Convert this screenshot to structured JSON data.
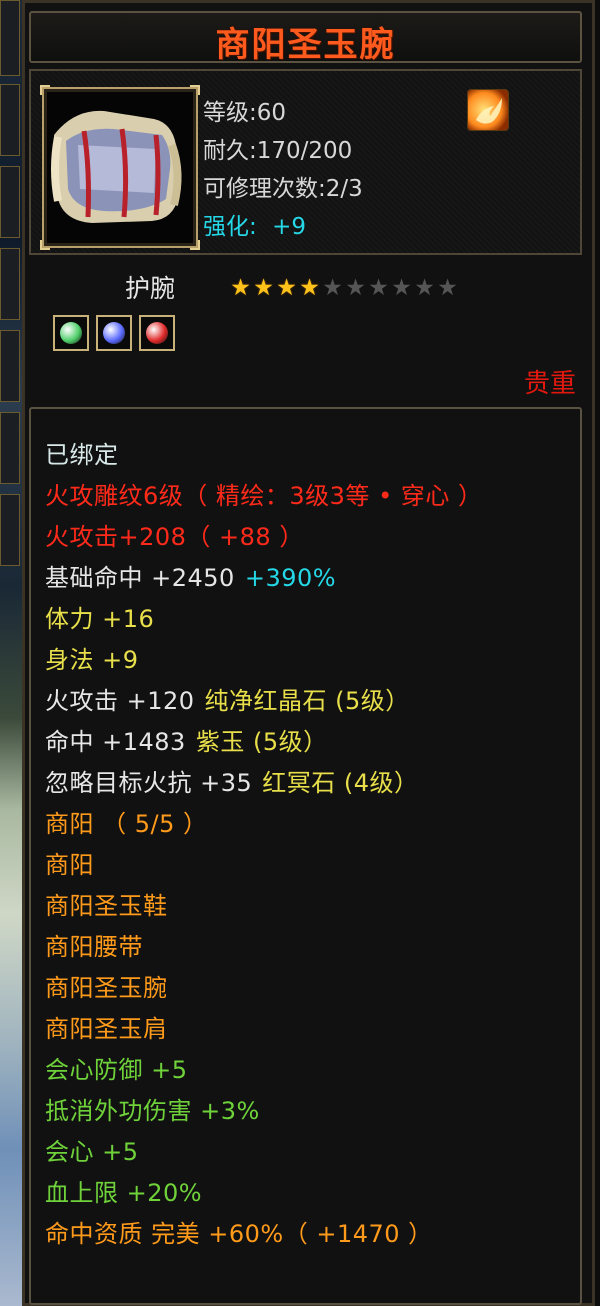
{
  "item": {
    "name": "商阳圣玉腕",
    "level": "等级:60",
    "durability": "耐久:170/200",
    "repairs": "可修理次数:2/3",
    "strength_label": "强化:",
    "strength_value": "+9",
    "slot": "护腕",
    "stars_filled": 4,
    "stars_total": 10,
    "rarity": "贵重",
    "icon": "armguard-icon",
    "element_icon": "fire-element-icon"
  },
  "gems": [
    {
      "icon": "gem-green-icon",
      "color": "#4fcf6a"
    },
    {
      "icon": "gem-blue-icon",
      "color": "#5b6bff"
    },
    {
      "icon": "gem-red-icon",
      "color": "#e02a2a"
    }
  ],
  "colors": {
    "white": "#e6e6e6",
    "red": "#ff2a1a",
    "yellow": "#e8df4a",
    "cyan": "#25d8e8",
    "orange": "#ff9a1a",
    "green": "#6fd23a",
    "title": "#ff5a1e"
  },
  "lines": [
    {
      "text": "已绑定",
      "extra": "",
      "color": "#d8e8e8",
      "extra_color": ""
    },
    {
      "text": "火攻雕纹6级（ 精绘：3级3等 • 穿心 ）",
      "extra": "",
      "color": "#ff2a1a",
      "extra_color": ""
    },
    {
      "text": "火攻击+208（ +88 ）",
      "extra": "",
      "color": "#ff2a1a",
      "extra_color": ""
    },
    {
      "text": "基础命中 +2450",
      "extra": "+390%",
      "color": "#e6e6e6",
      "extra_color": "#25d8e8"
    },
    {
      "text": "体力 +16",
      "extra": "",
      "color": "#e8df4a",
      "extra_color": ""
    },
    {
      "text": "身法 +9",
      "extra": "",
      "color": "#e8df4a",
      "extra_color": ""
    },
    {
      "text": "火攻击 +120",
      "extra": "纯净红晶石 (5级）",
      "color": "#e6e6e6",
      "extra_color": "#e8df4a"
    },
    {
      "text": "命中 +1483",
      "extra": "紫玉 (5级）",
      "color": "#e6e6e6",
      "extra_color": "#e8df4a"
    },
    {
      "text": "忽略目标火抗 +35",
      "extra": "红冥石 (4级）",
      "color": "#e6e6e6",
      "extra_color": "#e8df4a"
    },
    {
      "text": "商阳 （ 5/5 ）",
      "extra": "",
      "color": "#ff9a1a",
      "extra_color": ""
    },
    {
      "text": "商阳",
      "extra": "",
      "color": "#ff9a1a",
      "extra_color": ""
    },
    {
      "text": "商阳圣玉鞋",
      "extra": "",
      "color": "#ff9a1a",
      "extra_color": ""
    },
    {
      "text": "商阳腰带",
      "extra": "",
      "color": "#ff9a1a",
      "extra_color": ""
    },
    {
      "text": "商阳圣玉腕",
      "extra": "",
      "color": "#ff9a1a",
      "extra_color": ""
    },
    {
      "text": "商阳圣玉肩",
      "extra": "",
      "color": "#ff9a1a",
      "extra_color": ""
    },
    {
      "text": "会心防御 +5",
      "extra": "",
      "color": "#6fd23a",
      "extra_color": ""
    },
    {
      "text": "抵消外功伤害 +3%",
      "extra": "",
      "color": "#6fd23a",
      "extra_color": ""
    },
    {
      "text": "会心 +5",
      "extra": "",
      "color": "#6fd23a",
      "extra_color": ""
    },
    {
      "text": "血上限 +20%",
      "extra": "",
      "color": "#6fd23a",
      "extra_color": ""
    },
    {
      "text": "命中资质  完美 +60%（ +1470 ）",
      "extra": "",
      "color": "#ff9a1a",
      "extra_color": ""
    }
  ]
}
